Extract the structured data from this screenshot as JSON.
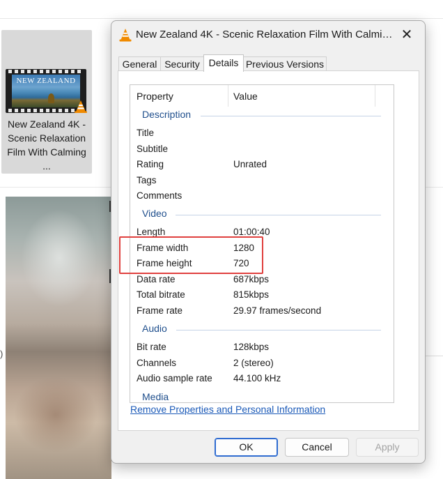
{
  "explorer": {
    "file_label": "New Zealand 4K - Scenic Relaxation Film With Calming ...",
    "thumbnail_text": "NEW ZEALAND",
    "side_text": ")"
  },
  "dialog": {
    "title": "New Zealand 4K - Scenic Relaxation Film With Calmin...",
    "close_glyph": "✕",
    "tabs": [
      {
        "label": "General"
      },
      {
        "label": "Security"
      },
      {
        "label": "Details"
      },
      {
        "label": "Previous Versions"
      }
    ],
    "active_tab": "Details",
    "columns": {
      "property": "Property",
      "value": "Value"
    },
    "groups": {
      "description": {
        "name": "Description",
        "rows": [
          {
            "property": "Title",
            "value": ""
          },
          {
            "property": "Subtitle",
            "value": ""
          },
          {
            "property": "Rating",
            "value": "Unrated"
          },
          {
            "property": "Tags",
            "value": ""
          },
          {
            "property": "Comments",
            "value": ""
          }
        ]
      },
      "video": {
        "name": "Video",
        "rows": [
          {
            "property": "Length",
            "value": "01:00:40"
          },
          {
            "property": "Frame width",
            "value": "1280"
          },
          {
            "property": "Frame height",
            "value": "720"
          },
          {
            "property": "Data rate",
            "value": "687kbps"
          },
          {
            "property": "Total bitrate",
            "value": "815kbps"
          },
          {
            "property": "Frame rate",
            "value": "29.97 frames/second"
          }
        ]
      },
      "audio": {
        "name": "Audio",
        "rows": [
          {
            "property": "Bit rate",
            "value": "128kbps"
          },
          {
            "property": "Channels",
            "value": "2 (stereo)"
          },
          {
            "property": "Audio sample rate",
            "value": "44.100 kHz"
          }
        ]
      },
      "media_partial": {
        "name": "Media"
      }
    },
    "remove_link": "Remove Properties and Personal Information",
    "buttons": {
      "ok": "OK",
      "cancel": "Cancel",
      "apply": "Apply"
    }
  },
  "colors": {
    "accent": "#2e6bd0",
    "group_heading": "#1e4e8c",
    "highlight_box": "#e0403e",
    "link": "#1b5ab8"
  }
}
